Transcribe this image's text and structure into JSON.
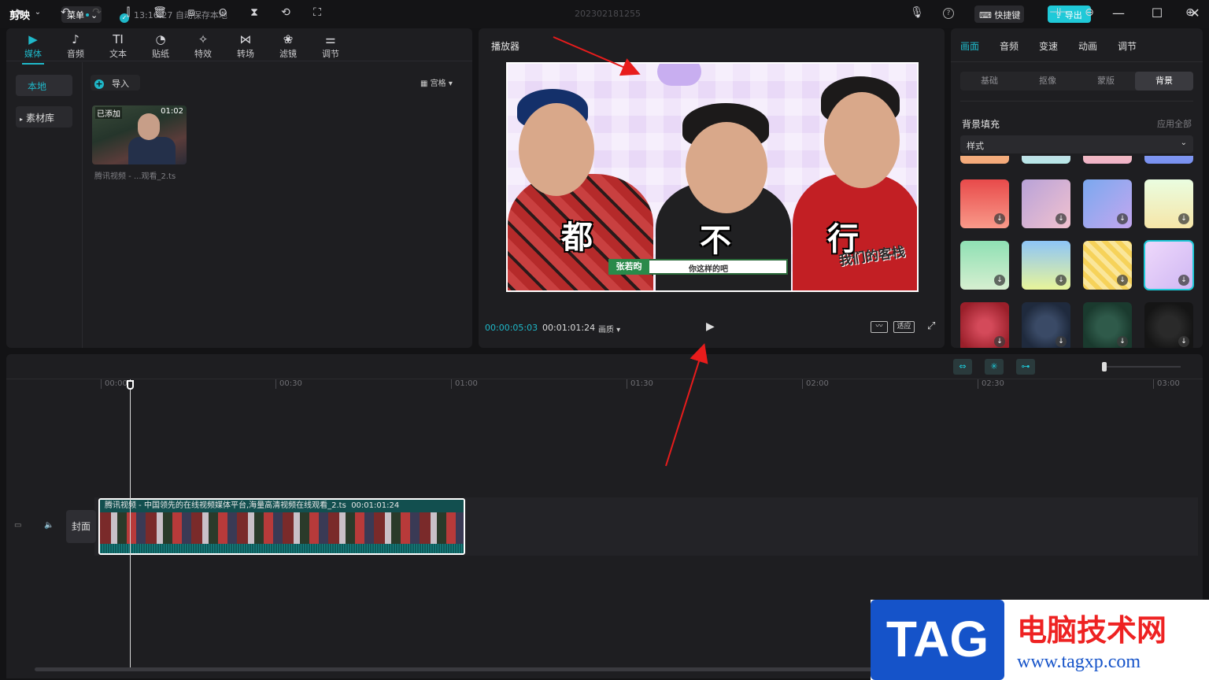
{
  "app": {
    "logo": "剪映",
    "menu_label": "菜单",
    "autosave": "13:16:27 自动保存本地",
    "project_title": "202302181255",
    "help": "?",
    "shortcut_label": "快捷键",
    "export_label": "导出",
    "window": {
      "minimize": "—",
      "maximize": "☐",
      "close": "✕"
    }
  },
  "media_tabs": [
    {
      "label": "媒体",
      "icon": "▶"
    },
    {
      "label": "音频",
      "icon": "♪"
    },
    {
      "label": "文本",
      "icon": "TI"
    },
    {
      "label": "贴纸",
      "icon": "◔"
    },
    {
      "label": "特效",
      "icon": "✧"
    },
    {
      "label": "转场",
      "icon": "⋈"
    },
    {
      "label": "滤镜",
      "icon": "❀"
    },
    {
      "label": "调节",
      "icon": "⚌"
    }
  ],
  "media_side": {
    "local": "本地",
    "library": "素材库"
  },
  "media_main": {
    "import_label": "导入",
    "view_label": "宫格",
    "item": {
      "badge": "已添加",
      "duration": "01:02",
      "name": "腾讯视频 - ...观看_2.ts"
    }
  },
  "player": {
    "title": "播放器",
    "subtitles": [
      "都",
      "不",
      "行"
    ],
    "name_tag": "张若昀",
    "caption": "你这样的吧",
    "show_logo": "我们的客栈",
    "current_time": "00:00:05:03",
    "total_time": "00:01:01:24",
    "quality_label": "画质",
    "fit_label": "适应",
    "play_icon": "▶"
  },
  "right_panel": {
    "tabs": [
      "画面",
      "音频",
      "变速",
      "动画",
      "调节"
    ],
    "active_tab": "画面",
    "subtabs": [
      "基础",
      "抠像",
      "蒙版",
      "背景"
    ],
    "active_subtab": "背景",
    "bg_fill_label": "背景填充",
    "apply_all_label": "应用全部",
    "style_label": "样式",
    "swatches": [
      {
        "name": "red",
        "bg": "linear-gradient(#e84a4a,#f99a8a)"
      },
      {
        "name": "lavender",
        "bg": "linear-gradient(135deg,#b8a2d8,#f2c2cf)"
      },
      {
        "name": "cloud-blue",
        "bg": "linear-gradient(135deg,#7aa8ef,#c4a7ef)"
      },
      {
        "name": "green-yellow",
        "bg": "linear-gradient(#eafde0,#f6e6a8)"
      },
      {
        "name": "mint",
        "bg": "linear-gradient(#8fe0b4,#d6efd0)"
      },
      {
        "name": "sky-lime",
        "bg": "linear-gradient(#8ec5f7,#e8f59a)"
      },
      {
        "name": "yellow-plaid",
        "bg": "repeating-linear-gradient(45deg,#f6d25a 0 6px,#fae69a 6px 12px)"
      },
      {
        "name": "purple-bunny",
        "bg": "linear-gradient(135deg,#efd9fb,#cfb7f3)"
      },
      {
        "name": "red-glitter",
        "bg": "radial-gradient(#d44a5a 20%,#9a1f2a 80%)"
      },
      {
        "name": "navy-dots",
        "bg": "radial-gradient(#3a4a66 30%,#1f2a3d 70%)"
      },
      {
        "name": "green-dots",
        "bg": "radial-gradient(#2f5a4a 30%,#1a3a2e 70%)"
      },
      {
        "name": "black-dots",
        "bg": "radial-gradient(#2a2a2a 30%,#151515 70%)"
      }
    ],
    "selected_swatch": 7
  },
  "timeline": {
    "ruler": [
      "00:00",
      "00:30",
      "01:00",
      "01:30",
      "02:00",
      "02:30",
      "03:00"
    ],
    "cover_label": "封面",
    "clip_name": "腾讯视频 - 中国领先的在线视频媒体平台,海量高清视频在线观看_2.ts",
    "clip_duration": "00:01:01:24"
  },
  "watermark": {
    "tag": "TAG",
    "cn": "电脑技术网",
    "url": "www.tagxp.com"
  }
}
